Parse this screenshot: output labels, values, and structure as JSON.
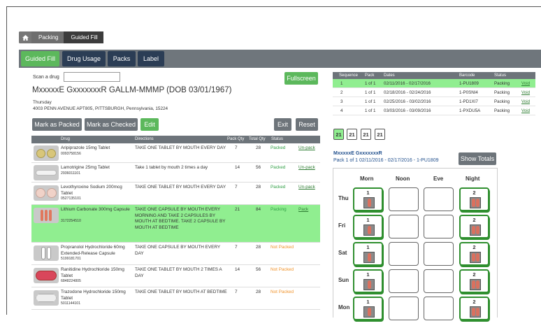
{
  "breadcrumb": {
    "items": [
      "Packing",
      "Guided Fill"
    ]
  },
  "tabs": [
    "Guided Fill",
    "Drug Usage",
    "Packs",
    "Label"
  ],
  "scan": {
    "label": "Scan a drug",
    "value": ""
  },
  "fullscreen": "Fullscreen",
  "patient": {
    "title": "MxxxxxE GxxxxxxxR GALLM-MMMP (DOB 03/01/1967)",
    "day": "Thursday",
    "address": "4003 PENN AVENUE APT805, PITTSBURGH, Pennsylvania, 15224"
  },
  "actions": {
    "mark_packed": "Mark as Packed",
    "mark_checked": "Mark as Checked",
    "edit": "Edit",
    "exit": "Exit",
    "reset": "Reset"
  },
  "drug_table": {
    "headers": [
      "Drug",
      "Directions",
      "Pack Qty",
      "Total Qty",
      "Status"
    ],
    "rows": [
      {
        "name": "Aripiprazole 15mg Tablet",
        "code": "0093758156",
        "directions": "TAKE ONE TABLET BY MOUTH EVERY DAY",
        "pack_qty": "7",
        "total_qty": "28",
        "status": "Packed",
        "action": "Un-pack",
        "pill": "yellow-round"
      },
      {
        "name": "Lamotrigine 25mg Tablet",
        "code": "2936011101",
        "directions": "Take 1 tablet by mouth 2 times a day",
        "pack_qty": "14",
        "total_qty": "56",
        "status": "Packed",
        "action": "Un-pack",
        "pill": "white-oval"
      },
      {
        "name": "Levothyroxine Sodium 200mcg Tablet",
        "code": "0527135101",
        "directions": "TAKE ONE TABLET BY MOUTH EVERY DAY",
        "pack_qty": "7",
        "total_qty": "28",
        "status": "Packed",
        "action": "Un-pack",
        "pill": "pink-round"
      },
      {
        "name": "Lithium Carbonate 300mg Capsule",
        "code": "3172254510",
        "directions": "TAKE ONE CAPSULE BY MOUTH EVERY MORNING AND TAKE 2 CAPSULES BY MOUTH AT BEDTIME. TAKE 2 CAPSULE BY MOUTH AT BEDTIME",
        "pack_qty": "21",
        "total_qty": "84",
        "status": "Packing",
        "action": "Pack",
        "pill": "orange-capsule"
      },
      {
        "name": "Propranolol Hydrochloride 60mg Extended-Release Capsule",
        "code": "5199181701",
        "directions": "TAKE ONE CAPSULE BY MOUTH EVERY DAY",
        "pack_qty": "7",
        "total_qty": "28",
        "status": "Not Packed",
        "action": "",
        "pill": "white-capsule"
      },
      {
        "name": "Ranitidine Hydrochloride 150mg Tablet",
        "code": "6848224805",
        "directions": "TAKE ONE TABLET BY MOUTH 2 TIMES A DAY",
        "pack_qty": "14",
        "total_qty": "56",
        "status": "Not Packed",
        "action": "",
        "pill": "red-oval"
      },
      {
        "name": "Trazodone Hydrochloride 150mg Tablet",
        "code": "5011144101",
        "directions": "TAKE ONE TABLET BY MOUTH AT BEDTIME",
        "pack_qty": "7",
        "total_qty": "28",
        "status": "Not Packed",
        "action": "",
        "pill": "white-bar"
      }
    ]
  },
  "seq_table": {
    "headers": [
      "Sequence",
      "Pack",
      "Dates",
      "Barcode",
      "Status"
    ],
    "rows": [
      {
        "seq": "1",
        "pack": "1 of 1",
        "dates": "02/11/2016 - 02/17/2016",
        "barcode": "1-PU1809",
        "status": "Packing",
        "action": "Void"
      },
      {
        "seq": "2",
        "pack": "1 of 1",
        "dates": "02/18/2016 - 02/24/2016",
        "barcode": "1-P0SNI4",
        "status": "Packing",
        "action": "Void"
      },
      {
        "seq": "3",
        "pack": "1 of 1",
        "dates": "02/25/2016 - 03/02/2016",
        "barcode": "1-PD1XI7",
        "status": "Packing",
        "action": "Void"
      },
      {
        "seq": "4",
        "pack": "1 of 1",
        "dates": "03/03/2016 - 03/09/2016",
        "barcode": "1-PXDU5A",
        "status": "Packing",
        "action": "Void"
      }
    ]
  },
  "day_counts": [
    "21",
    "21",
    "21",
    "21"
  ],
  "pack": {
    "name": "MxxxxxE GxxxxxxxR",
    "line": "Pack 1 of 1 02/11/2016 - 02/17/2016 - 1-PU1809",
    "show_totals": "Show Totals"
  },
  "grid": {
    "columns": [
      "Morn",
      "Noon",
      "Eve",
      "Night"
    ],
    "rows": [
      {
        "day": "Thu",
        "morn": "1",
        "night": "2"
      },
      {
        "day": "Fri",
        "morn": "1",
        "night": "2"
      },
      {
        "day": "Sat",
        "morn": "1",
        "night": "2"
      },
      {
        "day": "Sun",
        "morn": "1",
        "night": "2"
      },
      {
        "day": "Mon",
        "morn": "1",
        "night": "2"
      }
    ]
  },
  "colors": {
    "accent": "#5cb85c",
    "highlight": "#90ee90",
    "header": "#6d747a",
    "warning": "#f0932b"
  }
}
